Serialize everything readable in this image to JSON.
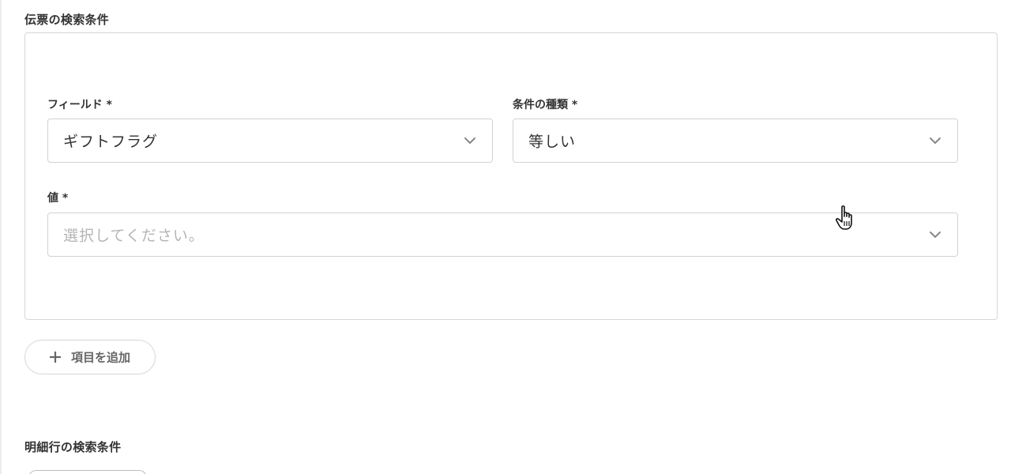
{
  "header_conditions": {
    "title": "伝票の検索条件",
    "fields": {
      "field": {
        "label": "フィールド *",
        "value": "ギフトフラグ"
      },
      "condition_type": {
        "label": "条件の種類 *",
        "value": "等しい"
      },
      "value": {
        "label": "値 *",
        "placeholder": "選択してください。",
        "value": ""
      }
    },
    "add_button_label": "項目を追加"
  },
  "line_conditions": {
    "title": "明細行の検索条件"
  },
  "icons": {
    "dropdown": "chevron-down-icon",
    "add": "plus-icon",
    "cursor": "hand-pointer-icon"
  },
  "colors": {
    "border": "#d6d6d6",
    "text": "#333333",
    "placeholder": "#b5b5b5",
    "chevron": "#888888"
  }
}
